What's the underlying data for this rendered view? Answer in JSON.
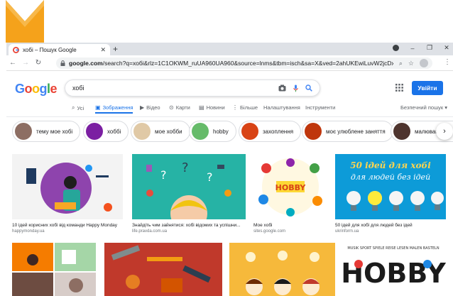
{
  "browser": {
    "tab_title": "хобі – Пошук Google",
    "tab_close": "✕",
    "new_tab": "+",
    "url_host": "google.com",
    "url_rest": "/search?q=хобі&rlz=1C1OKWM_ruUA960UA960&source=lnms&tbm=isch&sa=X&ved=2ahUKEwiLuvW2jcDxAhVnwos...",
    "win_minimize": "–",
    "win_restore": "❐",
    "win_close": "✕"
  },
  "google": {
    "logo_letters": [
      "G",
      "o",
      "o",
      "g",
      "l",
      "e"
    ],
    "logo_colors": [
      "#4285f4",
      "#ea4335",
      "#fbbc05",
      "#4285f4",
      "#34a853",
      "#ea4335"
    ],
    "search_query": "хобі",
    "signin_label": "Увійти",
    "tabs": [
      {
        "label": "Усі",
        "icon": "search-icon"
      },
      {
        "label": "Зображення",
        "icon": "image-icon",
        "active": true
      },
      {
        "label": "Відео",
        "icon": "video-icon"
      },
      {
        "label": "Карти",
        "icon": "map-pin-icon"
      },
      {
        "label": "Новини",
        "icon": "news-icon"
      },
      {
        "label": "Більше",
        "icon": "more-icon"
      },
      {
        "label": "Налаштування",
        "icon": ""
      },
      {
        "label": "Інструменти",
        "icon": ""
      }
    ],
    "safe_search": "Безпечний пошук ▾",
    "accent": "#1a73e8"
  },
  "chips": [
    {
      "label": "тему мое хобі",
      "color": "#8d6e63"
    },
    {
      "label": "хоббі",
      "color": "#7b1fa2"
    },
    {
      "label": "мое хобби",
      "color": "#e0c9a6"
    },
    {
      "label": "hobby",
      "color": "#66bb6a"
    },
    {
      "label": "захоплення",
      "color": "#d84315"
    },
    {
      "label": "моє улюблене заняття",
      "color": "#bf360c"
    },
    {
      "label": "малюванн",
      "color": "#4e342e"
    }
  ],
  "results_row1": [
    {
      "title": "10 ідей корисних хобі від команди Happy Monday",
      "source": "happymonday.ua"
    },
    {
      "title": "Знайдіть чим зайнятися: хобі відомих та успішни...",
      "source": "life.pravda.com.ua"
    },
    {
      "title": "Мое хобі",
      "source": "sites.google.com"
    },
    {
      "title": "50 ідей для хобі для людей без ідей",
      "source": "ukrinform.ua"
    }
  ],
  "image_text": {
    "hobby_badge": "HOBBY",
    "ideas_line1": "50 ідей для хобі",
    "ideas_line2": "для людей без ідей",
    "hobby_big": "HOBBY",
    "hobby_caption": "MUSIK SPORT SPIELE REISE LESEN MALEN BASTELN"
  }
}
